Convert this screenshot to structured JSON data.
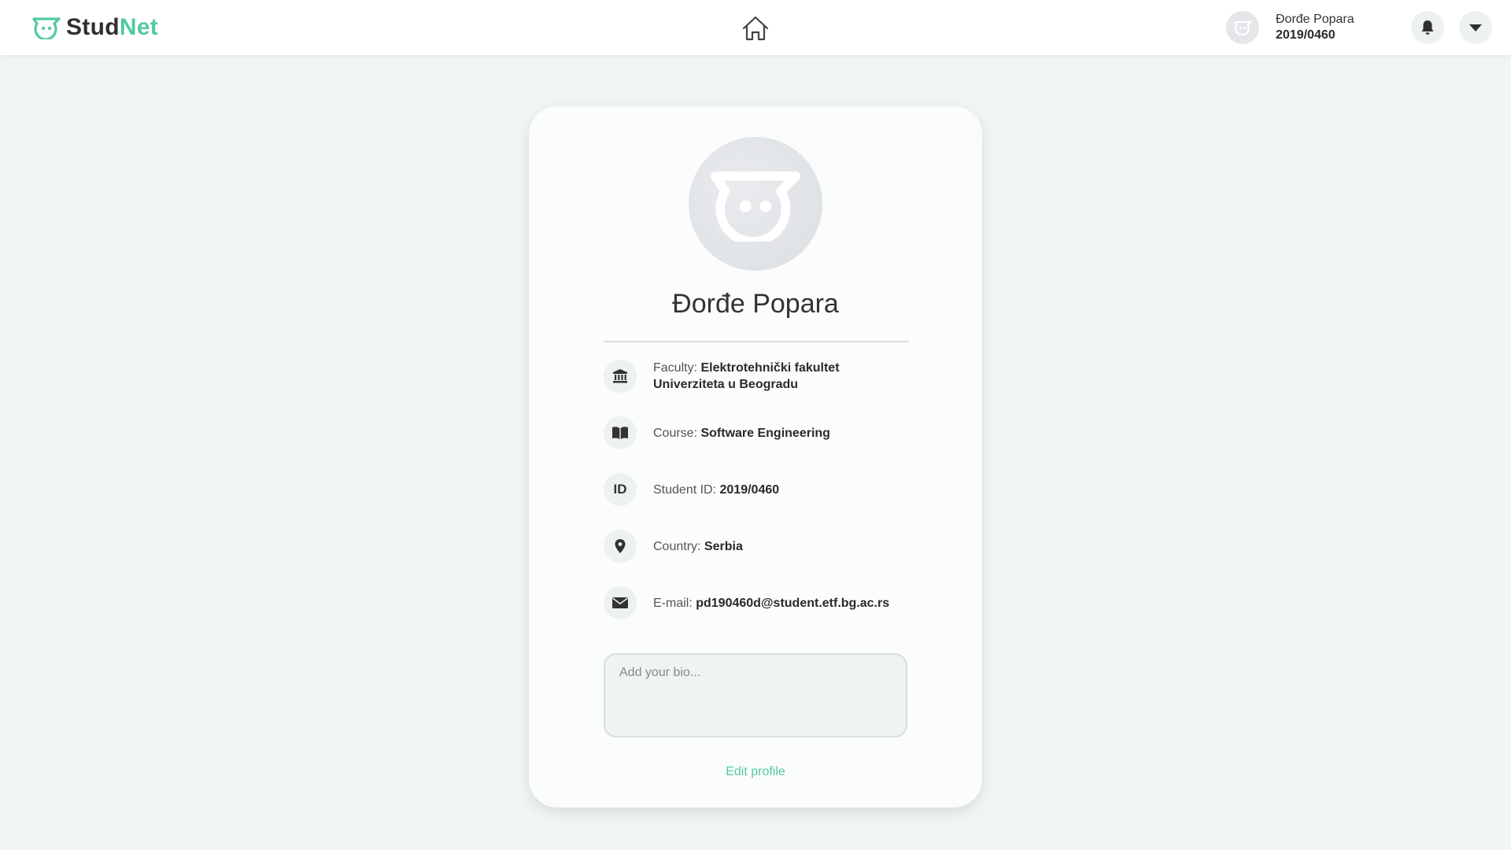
{
  "header": {
    "logo": {
      "part1": "Stud",
      "part2": "Net",
      "icon": "studnet-logo-icon"
    },
    "home_icon": "home-icon",
    "user": {
      "name": "Đorđe Popara",
      "student_id": "2019/0460"
    },
    "bell_icon": "bell-icon",
    "dropdown_icon": "caret-down-icon"
  },
  "profile": {
    "name": "Đorđe Popara",
    "fields": [
      {
        "icon": "bank-icon",
        "label": "Faculty: ",
        "value_line1": "Elektrotehnički fakultet",
        "value_line2": "Univerziteta u Beogradu"
      },
      {
        "icon": "book-icon",
        "label": "Course: ",
        "value": "Software Engineering"
      },
      {
        "icon": "id-icon",
        "icon_text": "ID",
        "label": "Student ID: ",
        "value": "2019/0460"
      },
      {
        "icon": "map-pin-icon",
        "label": "Country: ",
        "value": "Serbia"
      },
      {
        "icon": "envelope-icon",
        "label": "E-mail: ",
        "value": "pd190460d@student.etf.bg.ac.rs"
      }
    ],
    "bio_placeholder": "Add your bio...",
    "edit_label": "Edit profile"
  },
  "colors": {
    "accent": "#52c9a1",
    "background": "#f0f5f5",
    "card": "#fbfcfc"
  }
}
